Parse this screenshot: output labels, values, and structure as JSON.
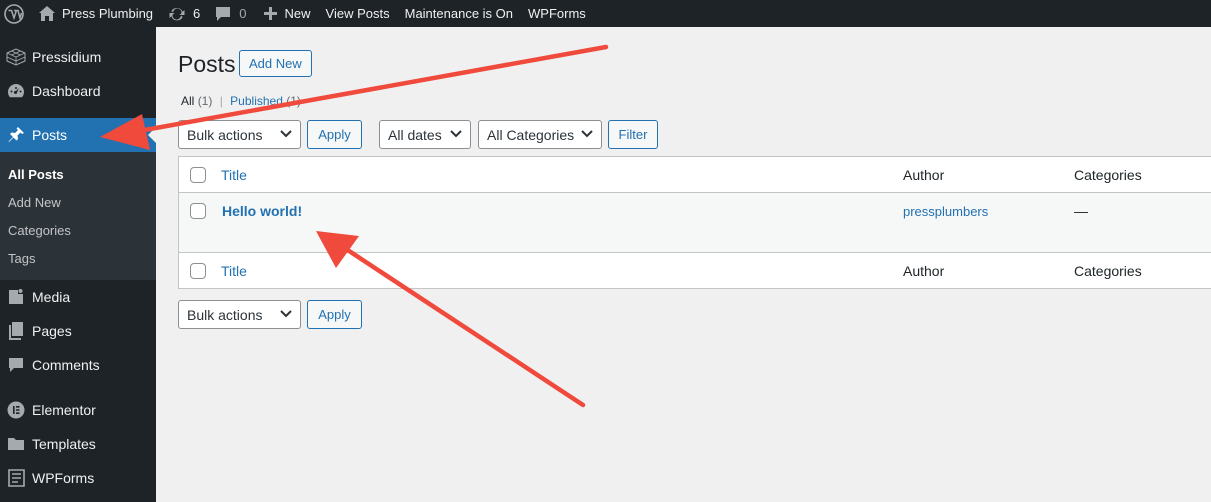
{
  "adminbar": {
    "site_name": "Press Plumbing",
    "updates_count": "6",
    "comments_count": "0",
    "new_label": "New",
    "view_posts": "View Posts",
    "maintenance": "Maintenance is On",
    "wpforms": "WPForms"
  },
  "sidebar": {
    "items": [
      {
        "label": "Pressidium",
        "icon": "grid-cube-icon"
      },
      {
        "label": "Dashboard",
        "icon": "dashboard-icon"
      },
      {
        "label": "Posts",
        "icon": "pushpin-icon",
        "active": true
      },
      {
        "label": "Media",
        "icon": "media-icon"
      },
      {
        "label": "Pages",
        "icon": "pages-icon"
      },
      {
        "label": "Comments",
        "icon": "comment-icon"
      },
      {
        "label": "Elementor",
        "icon": "elementor-icon"
      },
      {
        "label": "Templates",
        "icon": "folder-icon"
      },
      {
        "label": "WPForms",
        "icon": "wpforms-icon"
      }
    ],
    "submenu": [
      "All Posts",
      "Add New",
      "Categories",
      "Tags"
    ]
  },
  "main": {
    "title": "Posts",
    "add_new": "Add New",
    "filters": {
      "all": "All",
      "all_count": "(1)",
      "separator": "|",
      "published": "Published",
      "published_count": "(1)"
    },
    "bulk_actions": "Bulk actions",
    "apply": "Apply",
    "dates": "All dates",
    "categories": "All Categories",
    "filter": "Filter",
    "table": {
      "columns": [
        "Title",
        "Author",
        "Categories"
      ],
      "rows": [
        {
          "title": "Hello world!",
          "author": "pressplumbers",
          "categories": "—"
        }
      ]
    }
  },
  "colors": {
    "adminbar_bg": "#1d2327",
    "sidebar_bg": "#1d2327",
    "submenu_bg": "#2c3338",
    "accent": "#2271b1",
    "annotation_arrow": "#f04a3c"
  }
}
